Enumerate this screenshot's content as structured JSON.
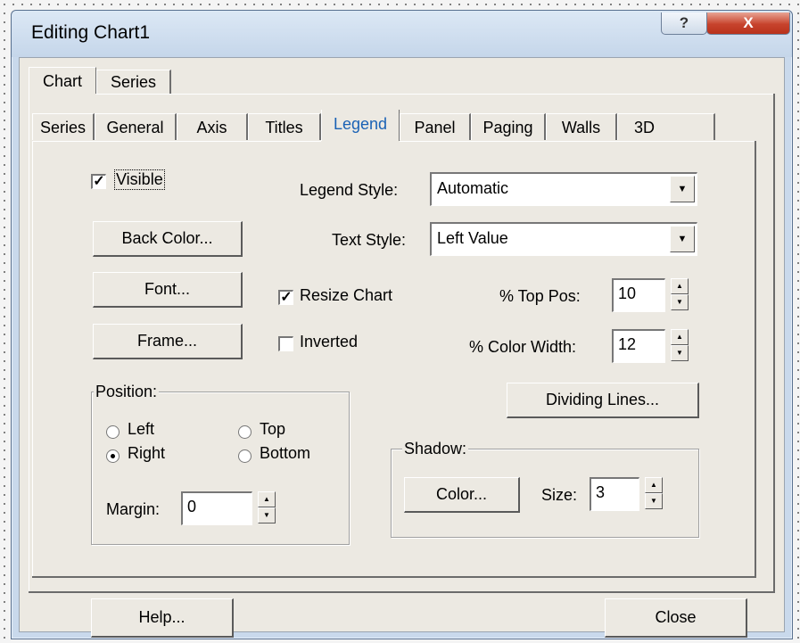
{
  "window": {
    "title": "Editing Chart1",
    "help_glyph": "?",
    "close_glyph": "X"
  },
  "outer_tabs": [
    {
      "label": "Chart",
      "active": true
    },
    {
      "label": "Series",
      "active": false
    }
  ],
  "inner_tabs": [
    {
      "label": "Series"
    },
    {
      "label": "General"
    },
    {
      "label": "Axis"
    },
    {
      "label": "Titles"
    },
    {
      "label": "Legend",
      "active": true
    },
    {
      "label": "Panel"
    },
    {
      "label": "Paging"
    },
    {
      "label": "Walls"
    },
    {
      "label": "3D"
    }
  ],
  "legend": {
    "visible": {
      "label": "Visible",
      "checked": true
    },
    "back_color_label": "Back Color...",
    "font_label": "Font...",
    "frame_label": "Frame...",
    "legend_style": {
      "label": "Legend Style:",
      "value": "Automatic"
    },
    "text_style": {
      "label": "Text Style:",
      "value": "Left Value"
    },
    "resize_chart": {
      "label": "Resize Chart",
      "checked": true
    },
    "inverted": {
      "label": "Inverted",
      "checked": false
    },
    "top_pos": {
      "label": "% Top Pos:",
      "value": "10"
    },
    "color_width": {
      "label": "% Color Width:",
      "value": "12"
    },
    "dividing_lines_label": "Dividing Lines...",
    "position": {
      "title": "Position:",
      "left": "Left",
      "right": "Right",
      "top": "Top",
      "bottom": "Bottom",
      "selected": "Right",
      "margin_label": "Margin:",
      "margin_value": "0"
    },
    "shadow": {
      "title": "Shadow:",
      "color_label": "Color...",
      "size_label": "Size:",
      "size_value": "3"
    }
  },
  "footer": {
    "help_label": "Help...",
    "close_label": "Close"
  },
  "colors": {
    "active_tab_text": "#1a62b5",
    "title_close_button": "#c7432d"
  }
}
